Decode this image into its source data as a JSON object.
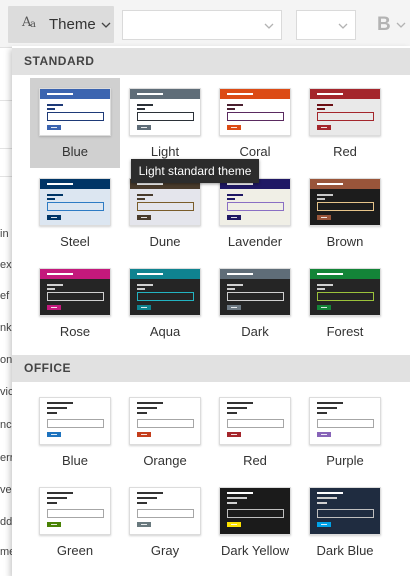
{
  "toolbar": {
    "theme_label": "Theme",
    "bold_label": "B"
  },
  "background": {
    "words": [
      "in",
      "ex",
      "ef",
      "nk",
      "on",
      "vic",
      "nc",
      "err",
      "ve",
      "dd",
      "me"
    ]
  },
  "standard": {
    "header": "STANDARD",
    "tooltip": "Light standard theme",
    "selected": "Blue",
    "themes": [
      {
        "name": "Blue",
        "top": "#3b64b0",
        "body": "#ffffff",
        "dash": "#1e3a78",
        "field": "#1e3a78",
        "button": "#3b64b0"
      },
      {
        "name": "Light",
        "top": "#5f6d78",
        "body": "#ffffff",
        "dash": "#2b3138",
        "field": "#2b3138",
        "button": "#5f6d78"
      },
      {
        "name": "Coral",
        "top": "#dc4b15",
        "body": "#ffffff",
        "dash": "#4a2030",
        "field": "#5a2a60",
        "button": "#dc4b15"
      },
      {
        "name": "Red",
        "top": "#a4262c",
        "body": "#e9e9e9",
        "dash": "#6b0f14",
        "field": "#a4262c",
        "button": "#a4262c"
      },
      {
        "name": "Steel",
        "top": "#003566",
        "body": "#dce6f1",
        "dash": "#003566",
        "field": "#2d7bc4",
        "button": "#003566"
      },
      {
        "name": "Dune",
        "top": "#493b2c",
        "body": "#e4e5ec",
        "dash": "#493b2c",
        "field": "#7a5c2a",
        "button": "#493b2c"
      },
      {
        "name": "Lavender",
        "top": "#1f1864",
        "body": "#f0efe6",
        "dash": "#1f1864",
        "field": "#8a6fc4",
        "button": "#1f1864"
      },
      {
        "name": "Brown",
        "top": "#99553a",
        "body": "#1c1c1c",
        "dash": "#c9c9c9",
        "field": "#e6c48a",
        "button": "#99553a"
      },
      {
        "name": "Rose",
        "top": "#c4197c",
        "body": "#252525",
        "dash": "#d0d0d0",
        "field": "#d0d0d0",
        "button": "#c4197c"
      },
      {
        "name": "Aqua",
        "top": "#0f8390",
        "body": "#252525",
        "dash": "#d0d0d0",
        "field": "#23b4c2",
        "button": "#0f8390"
      },
      {
        "name": "Dark",
        "top": "#5f6d78",
        "body": "#252525",
        "dash": "#d0d0d0",
        "field": "#d0d0d0",
        "button": "#6e7a84"
      },
      {
        "name": "Forest",
        "top": "#138438",
        "body": "#252525",
        "dash": "#d0d0d0",
        "field": "#9bc33b",
        "button": "#138438"
      }
    ]
  },
  "office": {
    "header": "OFFICE",
    "themes": [
      {
        "name": "Blue",
        "top": "#ffffff",
        "body": "#ffffff",
        "dash": "#333333",
        "field": "#a6a6a6",
        "button": "#1e73be"
      },
      {
        "name": "Orange",
        "top": "#ffffff",
        "body": "#ffffff",
        "dash": "#333333",
        "field": "#a6a6a6",
        "button": "#c43e1c"
      },
      {
        "name": "Red",
        "top": "#ffffff",
        "body": "#ffffff",
        "dash": "#333333",
        "field": "#a6a6a6",
        "button": "#a4262c"
      },
      {
        "name": "Purple",
        "top": "#ffffff",
        "body": "#ffffff",
        "dash": "#333333",
        "field": "#a6a6a6",
        "button": "#8764b8"
      },
      {
        "name": "Green",
        "top": "#ffffff",
        "body": "#ffffff",
        "dash": "#333333",
        "field": "#a6a6a6",
        "button": "#498205"
      },
      {
        "name": "Gray",
        "top": "#ffffff",
        "body": "#ffffff",
        "dash": "#333333",
        "field": "#a6a6a6",
        "button": "#69797e"
      },
      {
        "name": "Dark Yellow",
        "top": "#1b1b1b",
        "body": "#1b1b1b",
        "dash": "#d0d0d0",
        "field": "#bfbfbf",
        "button": "#fce100"
      },
      {
        "name": "Dark Blue",
        "top": "#1f2c40",
        "body": "#1f2c40",
        "dash": "#d0d0d0",
        "field": "#bfbfbf",
        "button": "#00a2e8"
      }
    ]
  }
}
